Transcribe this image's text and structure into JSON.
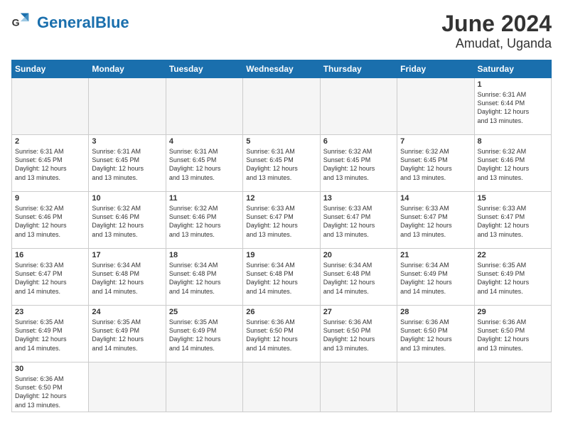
{
  "header": {
    "logo_general": "General",
    "logo_blue": "Blue",
    "month_year": "June 2024",
    "location": "Amudat, Uganda"
  },
  "weekdays": [
    "Sunday",
    "Monday",
    "Tuesday",
    "Wednesday",
    "Thursday",
    "Friday",
    "Saturday"
  ],
  "weeks": [
    [
      {
        "day": "",
        "info": ""
      },
      {
        "day": "",
        "info": ""
      },
      {
        "day": "",
        "info": ""
      },
      {
        "day": "",
        "info": ""
      },
      {
        "day": "",
        "info": ""
      },
      {
        "day": "",
        "info": ""
      },
      {
        "day": "1",
        "info": "Sunrise: 6:31 AM\nSunset: 6:44 PM\nDaylight: 12 hours\nand 13 minutes."
      }
    ],
    [
      {
        "day": "2",
        "info": "Sunrise: 6:31 AM\nSunset: 6:45 PM\nDaylight: 12 hours\nand 13 minutes."
      },
      {
        "day": "3",
        "info": "Sunrise: 6:31 AM\nSunset: 6:45 PM\nDaylight: 12 hours\nand 13 minutes."
      },
      {
        "day": "4",
        "info": "Sunrise: 6:31 AM\nSunset: 6:45 PM\nDaylight: 12 hours\nand 13 minutes."
      },
      {
        "day": "5",
        "info": "Sunrise: 6:31 AM\nSunset: 6:45 PM\nDaylight: 12 hours\nand 13 minutes."
      },
      {
        "day": "6",
        "info": "Sunrise: 6:32 AM\nSunset: 6:45 PM\nDaylight: 12 hours\nand 13 minutes."
      },
      {
        "day": "7",
        "info": "Sunrise: 6:32 AM\nSunset: 6:45 PM\nDaylight: 12 hours\nand 13 minutes."
      },
      {
        "day": "8",
        "info": "Sunrise: 6:32 AM\nSunset: 6:46 PM\nDaylight: 12 hours\nand 13 minutes."
      }
    ],
    [
      {
        "day": "9",
        "info": "Sunrise: 6:32 AM\nSunset: 6:46 PM\nDaylight: 12 hours\nand 13 minutes."
      },
      {
        "day": "10",
        "info": "Sunrise: 6:32 AM\nSunset: 6:46 PM\nDaylight: 12 hours\nand 13 minutes."
      },
      {
        "day": "11",
        "info": "Sunrise: 6:32 AM\nSunset: 6:46 PM\nDaylight: 12 hours\nand 13 minutes."
      },
      {
        "day": "12",
        "info": "Sunrise: 6:33 AM\nSunset: 6:47 PM\nDaylight: 12 hours\nand 13 minutes."
      },
      {
        "day": "13",
        "info": "Sunrise: 6:33 AM\nSunset: 6:47 PM\nDaylight: 12 hours\nand 13 minutes."
      },
      {
        "day": "14",
        "info": "Sunrise: 6:33 AM\nSunset: 6:47 PM\nDaylight: 12 hours\nand 13 minutes."
      },
      {
        "day": "15",
        "info": "Sunrise: 6:33 AM\nSunset: 6:47 PM\nDaylight: 12 hours\nand 13 minutes."
      }
    ],
    [
      {
        "day": "16",
        "info": "Sunrise: 6:33 AM\nSunset: 6:47 PM\nDaylight: 12 hours\nand 14 minutes."
      },
      {
        "day": "17",
        "info": "Sunrise: 6:34 AM\nSunset: 6:48 PM\nDaylight: 12 hours\nand 14 minutes."
      },
      {
        "day": "18",
        "info": "Sunrise: 6:34 AM\nSunset: 6:48 PM\nDaylight: 12 hours\nand 14 minutes."
      },
      {
        "day": "19",
        "info": "Sunrise: 6:34 AM\nSunset: 6:48 PM\nDaylight: 12 hours\nand 14 minutes."
      },
      {
        "day": "20",
        "info": "Sunrise: 6:34 AM\nSunset: 6:48 PM\nDaylight: 12 hours\nand 14 minutes."
      },
      {
        "day": "21",
        "info": "Sunrise: 6:34 AM\nSunset: 6:49 PM\nDaylight: 12 hours\nand 14 minutes."
      },
      {
        "day": "22",
        "info": "Sunrise: 6:35 AM\nSunset: 6:49 PM\nDaylight: 12 hours\nand 14 minutes."
      }
    ],
    [
      {
        "day": "23",
        "info": "Sunrise: 6:35 AM\nSunset: 6:49 PM\nDaylight: 12 hours\nand 14 minutes."
      },
      {
        "day": "24",
        "info": "Sunrise: 6:35 AM\nSunset: 6:49 PM\nDaylight: 12 hours\nand 14 minutes."
      },
      {
        "day": "25",
        "info": "Sunrise: 6:35 AM\nSunset: 6:49 PM\nDaylight: 12 hours\nand 14 minutes."
      },
      {
        "day": "26",
        "info": "Sunrise: 6:36 AM\nSunset: 6:50 PM\nDaylight: 12 hours\nand 14 minutes."
      },
      {
        "day": "27",
        "info": "Sunrise: 6:36 AM\nSunset: 6:50 PM\nDaylight: 12 hours\nand 13 minutes."
      },
      {
        "day": "28",
        "info": "Sunrise: 6:36 AM\nSunset: 6:50 PM\nDaylight: 12 hours\nand 13 minutes."
      },
      {
        "day": "29",
        "info": "Sunrise: 6:36 AM\nSunset: 6:50 PM\nDaylight: 12 hours\nand 13 minutes."
      }
    ],
    [
      {
        "day": "30",
        "info": "Sunrise: 6:36 AM\nSunset: 6:50 PM\nDaylight: 12 hours\nand 13 minutes."
      },
      {
        "day": "",
        "info": ""
      },
      {
        "day": "",
        "info": ""
      },
      {
        "day": "",
        "info": ""
      },
      {
        "day": "",
        "info": ""
      },
      {
        "day": "",
        "info": ""
      },
      {
        "day": "",
        "info": ""
      }
    ]
  ]
}
